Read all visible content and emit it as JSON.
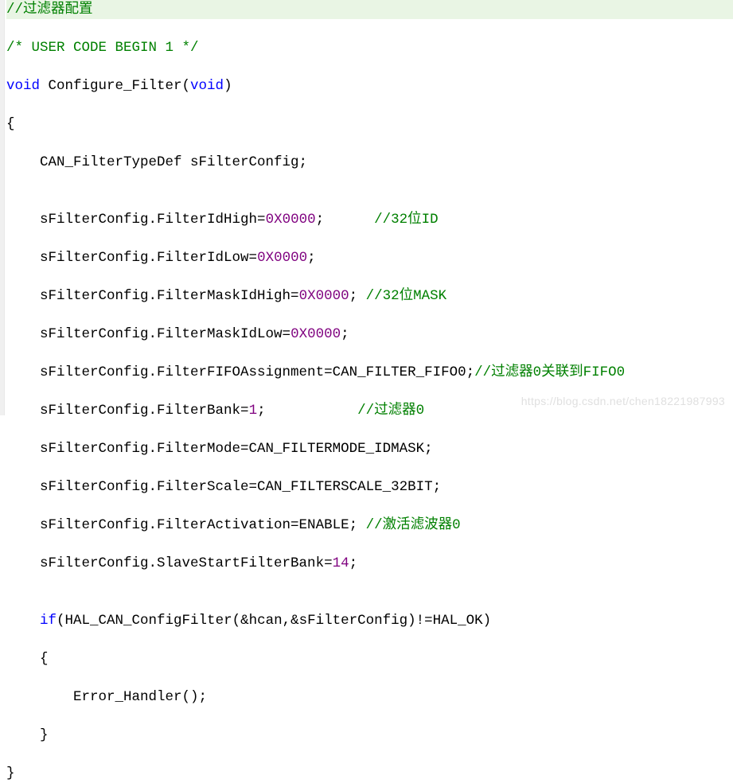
{
  "code": {
    "l1_comment": "//过滤器配置",
    "l2_comment": "/* USER CODE BEGIN 1 */",
    "l3_kw1": "void",
    "l3_fn": " Configure_Filter(",
    "l3_kw2": "void",
    "l3_tail": ")",
    "l4": "{",
    "l5": "    CAN_FilterTypeDef sFilterConfig;",
    "l6": "",
    "l7a": "    sFilterConfig.FilterIdHigh=",
    "l7b": "0X0000",
    "l7c": ";      ",
    "l7d": "//32位ID",
    "l8a": "    sFilterConfig.FilterIdLow=",
    "l8b": "0X0000",
    "l8c": ";",
    "l9a": "    sFilterConfig.FilterMaskIdHigh=",
    "l9b": "0X0000",
    "l9c": "; ",
    "l9d": "//32位MASK",
    "l10a": "    sFilterConfig.FilterMaskIdLow=",
    "l10b": "0X0000",
    "l10c": ";",
    "l11a": "    sFilterConfig.FilterFIFOAssignment=CAN_FILTER_FIFO0;",
    "l11b": "//过滤器0关联到FIFO0",
    "l12a": "    sFilterConfig.FilterBank=",
    "l12b": "1",
    "l12c": ";           ",
    "l12d": "//过滤器0",
    "l13": "    sFilterConfig.FilterMode=CAN_FILTERMODE_IDMASK;",
    "l14": "    sFilterConfig.FilterScale=CAN_FILTERSCALE_32BIT;",
    "l15a": "    sFilterConfig.FilterActivation=ENABLE; ",
    "l15b": "//激活滤波器0",
    "l16a": "    sFilterConfig.SlaveStartFilterBank=",
    "l16b": "14",
    "l16c": ";",
    "l17": "",
    "l18a": "    ",
    "l18b": "if",
    "l18c": "(HAL_CAN_ConfigFilter(&hcan,&sFilterConfig)!=HAL_OK)",
    "l19": "    {",
    "l20": "        Error_Handler();",
    "l21": "    }",
    "l22": "}"
  },
  "watermark": "https://blog.csdn.net/chen18221987993"
}
